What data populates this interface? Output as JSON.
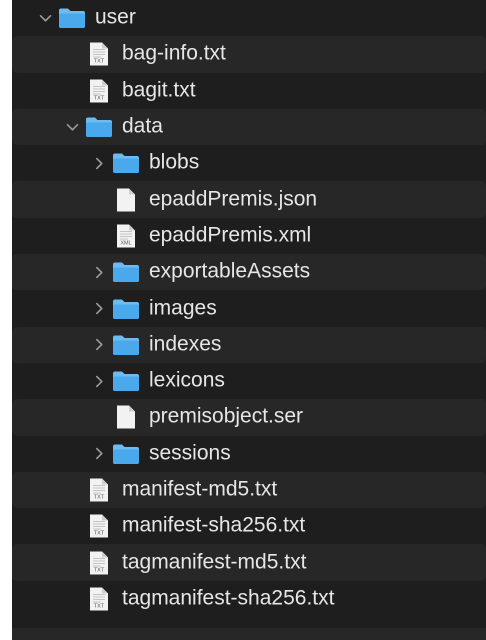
{
  "tree": [
    {
      "label": "user",
      "type": "folder",
      "depth": 0,
      "chevron": "down"
    },
    {
      "label": "bag-info.txt",
      "type": "file",
      "badge": "TXT",
      "depth": 1
    },
    {
      "label": "bagit.txt",
      "type": "file",
      "badge": "TXT",
      "depth": 1
    },
    {
      "label": "data",
      "type": "folder",
      "depth": 1,
      "chevron": "down"
    },
    {
      "label": "blobs",
      "type": "folder",
      "depth": 2,
      "chevron": "right"
    },
    {
      "label": "epaddPremis.json",
      "type": "file",
      "badge": "",
      "depth": 2
    },
    {
      "label": "epaddPremis.xml",
      "type": "file",
      "badge": "XML",
      "depth": 2
    },
    {
      "label": "exportableAssets",
      "type": "folder",
      "depth": 2,
      "chevron": "right"
    },
    {
      "label": "images",
      "type": "folder",
      "depth": 2,
      "chevron": "right"
    },
    {
      "label": "indexes",
      "type": "folder",
      "depth": 2,
      "chevron": "right"
    },
    {
      "label": "lexicons",
      "type": "folder",
      "depth": 2,
      "chevron": "right"
    },
    {
      "label": "premisobject.ser",
      "type": "file",
      "badge": "",
      "depth": 2
    },
    {
      "label": "sessions",
      "type": "folder",
      "depth": 2,
      "chevron": "right"
    },
    {
      "label": "manifest-md5.txt",
      "type": "file",
      "badge": "TXT",
      "depth": 1
    },
    {
      "label": "manifest-sha256.txt",
      "type": "file",
      "badge": "TXT",
      "depth": 1
    },
    {
      "label": "tagmanifest-md5.txt",
      "type": "file",
      "badge": "TXT",
      "depth": 1
    },
    {
      "label": "tagmanifest-sha256.txt",
      "type": "file",
      "badge": "TXT",
      "depth": 1
    }
  ],
  "colors": {
    "background": "#1e1e1e",
    "alt_row": "#272727",
    "text": "#e6e6e6",
    "folder": "#4aa8ec",
    "folder_tab": "#6cbcf2",
    "doc": "#f2f2f2"
  }
}
